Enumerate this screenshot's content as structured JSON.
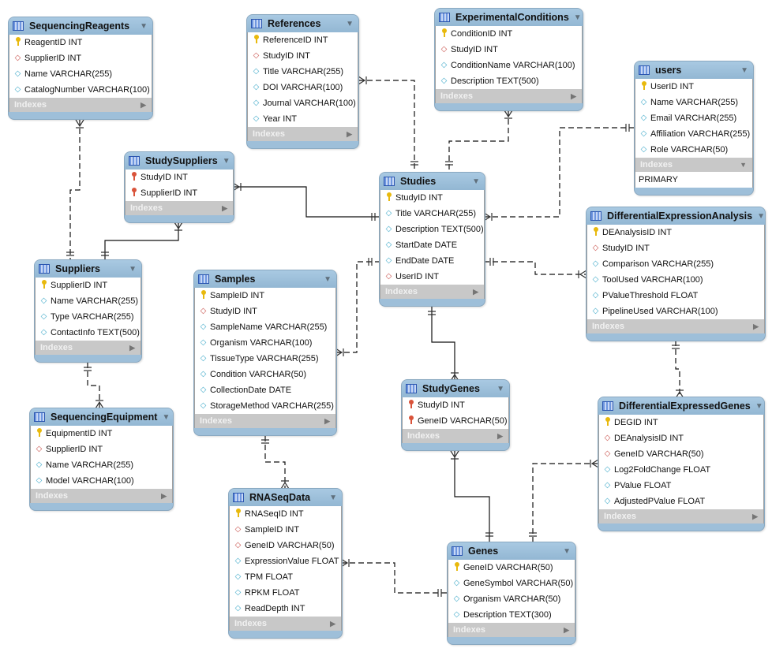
{
  "diagram": {
    "tables": [
      {
        "id": "SequencingReagents",
        "name": "SequencingReagents",
        "indexes_expanded": false,
        "columns": [
          {
            "name": "ReagentID INT",
            "kind": "pk"
          },
          {
            "name": "SupplierID INT",
            "kind": "fk"
          },
          {
            "name": "Name VARCHAR(255)",
            "kind": "attr"
          },
          {
            "name": "CatalogNumber VARCHAR(100)",
            "kind": "attr"
          }
        ]
      },
      {
        "id": "References",
        "name": "References",
        "indexes_expanded": false,
        "columns": [
          {
            "name": "ReferenceID INT",
            "kind": "pk"
          },
          {
            "name": "StudyID INT",
            "kind": "fk"
          },
          {
            "name": "Title VARCHAR(255)",
            "kind": "attr"
          },
          {
            "name": "DOI VARCHAR(100)",
            "kind": "attr"
          },
          {
            "name": "Journal VARCHAR(100)",
            "kind": "attr"
          },
          {
            "name": "Year INT",
            "kind": "attr"
          }
        ]
      },
      {
        "id": "ExperimentalConditions",
        "name": "ExperimentalConditions",
        "indexes_expanded": false,
        "columns": [
          {
            "name": "ConditionID INT",
            "kind": "pk"
          },
          {
            "name": "StudyID INT",
            "kind": "fk"
          },
          {
            "name": "ConditionName VARCHAR(100)",
            "kind": "attr"
          },
          {
            "name": "Description TEXT(500)",
            "kind": "attr"
          }
        ]
      },
      {
        "id": "users",
        "name": "users",
        "indexes_expanded": true,
        "index_items": [
          "PRIMARY"
        ],
        "columns": [
          {
            "name": "UserID INT",
            "kind": "pk"
          },
          {
            "name": "Name VARCHAR(255)",
            "kind": "attr"
          },
          {
            "name": "Email VARCHAR(255)",
            "kind": "attr"
          },
          {
            "name": "Affiliation VARCHAR(255)",
            "kind": "attr"
          },
          {
            "name": "Role VARCHAR(50)",
            "kind": "attr"
          }
        ]
      },
      {
        "id": "StudySuppliers",
        "name": "StudySuppliers",
        "indexes_expanded": false,
        "columns": [
          {
            "name": "StudyID INT",
            "kind": "fkpk"
          },
          {
            "name": "SupplierID INT",
            "kind": "fkpk"
          }
        ]
      },
      {
        "id": "Studies",
        "name": "Studies",
        "indexes_expanded": false,
        "columns": [
          {
            "name": "StudyID INT",
            "kind": "pk"
          },
          {
            "name": "Title VARCHAR(255)",
            "kind": "attr"
          },
          {
            "name": "Description TEXT(500)",
            "kind": "attr"
          },
          {
            "name": "StartDate DATE",
            "kind": "attr"
          },
          {
            "name": "EndDate DATE",
            "kind": "attr"
          },
          {
            "name": "UserID INT",
            "kind": "fk"
          }
        ]
      },
      {
        "id": "DifferentialExpressionAnalysis",
        "name": "DifferentialExpressionAnalysis",
        "indexes_expanded": false,
        "columns": [
          {
            "name": "DEAnalysisID INT",
            "kind": "pk"
          },
          {
            "name": "StudyID INT",
            "kind": "fk"
          },
          {
            "name": "Comparison VARCHAR(255)",
            "kind": "attr"
          },
          {
            "name": "ToolUsed VARCHAR(100)",
            "kind": "attr"
          },
          {
            "name": "PValueThreshold FLOAT",
            "kind": "attr"
          },
          {
            "name": "PipelineUsed VARCHAR(100)",
            "kind": "attr"
          }
        ]
      },
      {
        "id": "Suppliers",
        "name": "Suppliers",
        "indexes_expanded": false,
        "columns": [
          {
            "name": "SupplierID INT",
            "kind": "pk"
          },
          {
            "name": "Name VARCHAR(255)",
            "kind": "attr"
          },
          {
            "name": "Type VARCHAR(255)",
            "kind": "attr"
          },
          {
            "name": "ContactInfo TEXT(500)",
            "kind": "attr"
          }
        ]
      },
      {
        "id": "Samples",
        "name": "Samples",
        "indexes_expanded": false,
        "columns": [
          {
            "name": "SampleID INT",
            "kind": "pk"
          },
          {
            "name": "StudyID INT",
            "kind": "fk"
          },
          {
            "name": "SampleName VARCHAR(255)",
            "kind": "attr"
          },
          {
            "name": "Organism VARCHAR(100)",
            "kind": "attr"
          },
          {
            "name": "TissueType VARCHAR(255)",
            "kind": "attr"
          },
          {
            "name": "Condition VARCHAR(50)",
            "kind": "attr"
          },
          {
            "name": "CollectionDate DATE",
            "kind": "attr"
          },
          {
            "name": "StorageMethod VARCHAR(255)",
            "kind": "attr"
          }
        ]
      },
      {
        "id": "StudyGenes",
        "name": "StudyGenes",
        "indexes_expanded": false,
        "columns": [
          {
            "name": "StudyID INT",
            "kind": "fkpk"
          },
          {
            "name": "GeneID VARCHAR(50)",
            "kind": "fkpk"
          }
        ]
      },
      {
        "id": "DifferentialExpressedGenes",
        "name": "DifferentialExpressedGenes",
        "indexes_expanded": false,
        "columns": [
          {
            "name": "DEGID INT",
            "kind": "pk"
          },
          {
            "name": "DEAnalysisID INT",
            "kind": "fk"
          },
          {
            "name": "GeneID VARCHAR(50)",
            "kind": "fk"
          },
          {
            "name": "Log2FoldChange FLOAT",
            "kind": "attr"
          },
          {
            "name": "PValue FLOAT",
            "kind": "attr"
          },
          {
            "name": "AdjustedPValue FLOAT",
            "kind": "attr"
          }
        ]
      },
      {
        "id": "SequencingEquipment",
        "name": "SequencingEquipment",
        "indexes_expanded": false,
        "columns": [
          {
            "name": "EquipmentID INT",
            "kind": "pk"
          },
          {
            "name": "SupplierID INT",
            "kind": "fk"
          },
          {
            "name": "Name VARCHAR(255)",
            "kind": "attr"
          },
          {
            "name": "Model VARCHAR(100)",
            "kind": "attr"
          }
        ]
      },
      {
        "id": "RNASeqData",
        "name": "RNASeqData",
        "indexes_expanded": false,
        "columns": [
          {
            "name": "RNASeqID INT",
            "kind": "pk"
          },
          {
            "name": "SampleID INT",
            "kind": "fk"
          },
          {
            "name": "GeneID VARCHAR(50)",
            "kind": "fk"
          },
          {
            "name": "ExpressionValue FLOAT",
            "kind": "attr"
          },
          {
            "name": "TPM FLOAT",
            "kind": "attr"
          },
          {
            "name": "RPKM FLOAT",
            "kind": "attr"
          },
          {
            "name": "ReadDepth INT",
            "kind": "attr"
          }
        ]
      },
      {
        "id": "Genes",
        "name": "Genes",
        "indexes_expanded": false,
        "columns": [
          {
            "name": "GeneID VARCHAR(50)",
            "kind": "pk"
          },
          {
            "name": "GeneSymbol VARCHAR(50)",
            "kind": "attr"
          },
          {
            "name": "Organism VARCHAR(50)",
            "kind": "attr"
          },
          {
            "name": "Description TEXT(300)",
            "kind": "attr"
          }
        ]
      }
    ],
    "indexes_label": "Indexes",
    "relationships": [
      {
        "from": "SequencingReagents",
        "to": "Suppliers",
        "identifying": false
      },
      {
        "from": "StudySuppliers",
        "to": "Suppliers",
        "identifying": true
      },
      {
        "from": "StudySuppliers",
        "to": "Studies",
        "identifying": true
      },
      {
        "from": "References",
        "to": "Studies",
        "identifying": false
      },
      {
        "from": "ExperimentalConditions",
        "to": "Studies",
        "identifying": false
      },
      {
        "from": "Studies",
        "to": "users",
        "identifying": false
      },
      {
        "from": "DifferentialExpressionAnalysis",
        "to": "Studies",
        "identifying": false
      },
      {
        "from": "Samples",
        "to": "Studies",
        "identifying": false
      },
      {
        "from": "StudyGenes",
        "to": "Studies",
        "identifying": true
      },
      {
        "from": "StudyGenes",
        "to": "Genes",
        "identifying": true
      },
      {
        "from": "DifferentialExpressedGenes",
        "to": "DifferentialExpressionAnalysis",
        "identifying": false
      },
      {
        "from": "DifferentialExpressedGenes",
        "to": "Genes",
        "identifying": false
      },
      {
        "from": "SequencingEquipment",
        "to": "Suppliers",
        "identifying": false
      },
      {
        "from": "RNASeqData",
        "to": "Samples",
        "identifying": false
      },
      {
        "from": "RNASeqData",
        "to": "Genes",
        "identifying": false
      }
    ],
    "icons": {
      "pk": "key-icon",
      "fkpk": "foreign-key-primary-icon",
      "fk": "foreign-key-diamond-icon",
      "attr": "column-diamond-icon",
      "table": "table-icon",
      "collapse": "triangle-down-icon",
      "expand": "triangle-right-icon"
    },
    "colors": {
      "header": "#9ebfd9",
      "indexes_bar": "#c8c8c8",
      "pk": "#e8b90d",
      "fk": "#c8504a",
      "attr": "#3fa9c9",
      "line": "#000000"
    }
  }
}
